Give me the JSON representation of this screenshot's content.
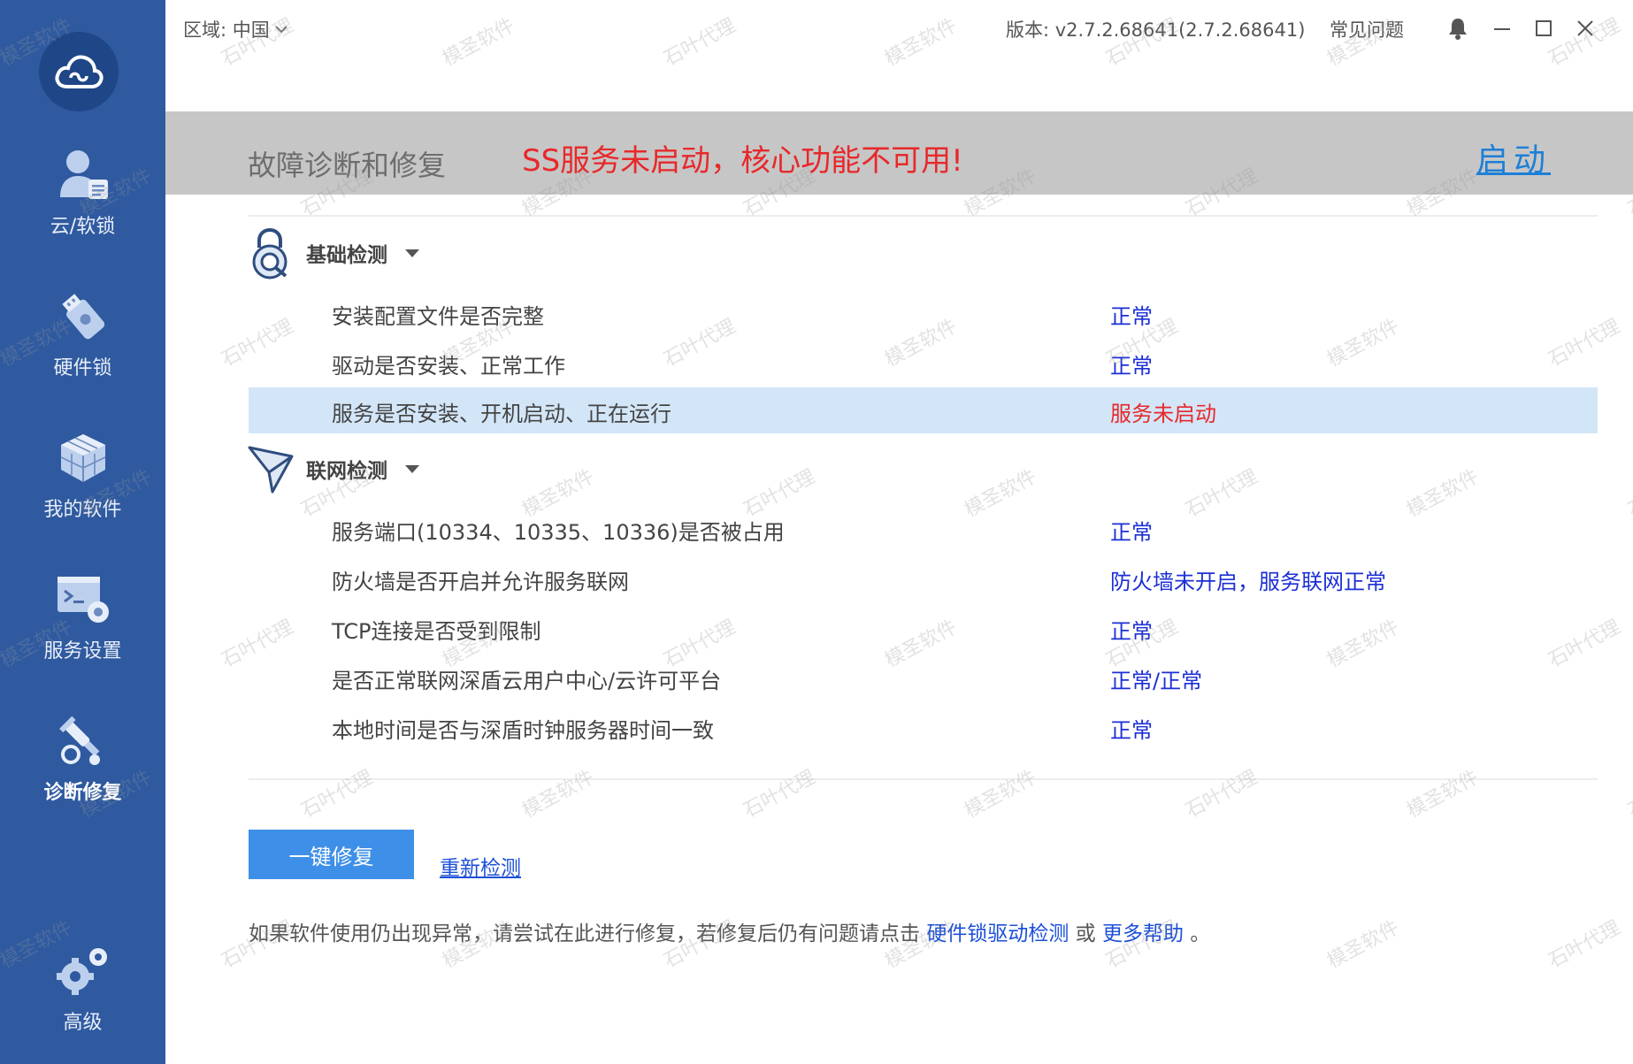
{
  "sidebar": {
    "items": [
      {
        "label": "云/软锁",
        "icon": "user-lock-icon"
      },
      {
        "label": "硬件锁",
        "icon": "usb-key-icon"
      },
      {
        "label": "我的软件",
        "icon": "cubes-icon"
      },
      {
        "label": "服务设置",
        "icon": "service-gear-icon"
      },
      {
        "label": "诊断修复",
        "icon": "wrench-icon"
      },
      {
        "label": "高级",
        "icon": "gears-icon"
      }
    ],
    "active_index": 4
  },
  "titlebar": {
    "region": "区域: 中国",
    "version": "版本: v2.7.2.68641(2.7.2.68641)",
    "faq": "常见问题"
  },
  "banner": {
    "title": "故障诊断和修复",
    "alert": "SS服务未启动，核心功能不可用!",
    "start": "启动"
  },
  "sections": [
    {
      "title": "基础检测",
      "rows": [
        {
          "label": "安装配置文件是否完整",
          "status": "正常"
        },
        {
          "label": "驱动是否安装、正常工作",
          "status": "正常"
        },
        {
          "label": "服务是否安装、开机启动、正在运行",
          "status": "服务未启动"
        }
      ]
    },
    {
      "title": "联网检测",
      "rows": [
        {
          "label": "服务端口(10334、10335、10336)是否被占用",
          "status": "正常"
        },
        {
          "label": "防火墙是否开启并允许服务联网",
          "status": "防火墙未开启，服务联网正常"
        },
        {
          "label": "TCP连接是否受到限制",
          "status": "正常"
        },
        {
          "label": "是否正常联网深盾云用户中心/云许可平台",
          "status": "正常/正常"
        },
        {
          "label": "本地时间是否与深盾时钟服务器时间一致",
          "status": "正常"
        }
      ]
    }
  ],
  "actions": {
    "fix": "一键修复",
    "recheck": "重新检测"
  },
  "hint": {
    "text_before": "如果软件使用仍出现异常，请尝试在此进行修复，若修复后仍有问题请点击 ",
    "link1": "硬件锁驱动检测",
    "middle": " 或 ",
    "link2": "更多帮助",
    "end": " 。"
  },
  "watermark": {
    "line1": "模圣软件",
    "line2": "石叶代理"
  },
  "colors": {
    "sidebar": "#2f5aa0",
    "banner": "#c6c6c6",
    "alert": "#e8282a",
    "status_ok": "#1c2fd6",
    "highlight_row": "#d3e6f8",
    "primary_button": "#3e8fe8"
  }
}
